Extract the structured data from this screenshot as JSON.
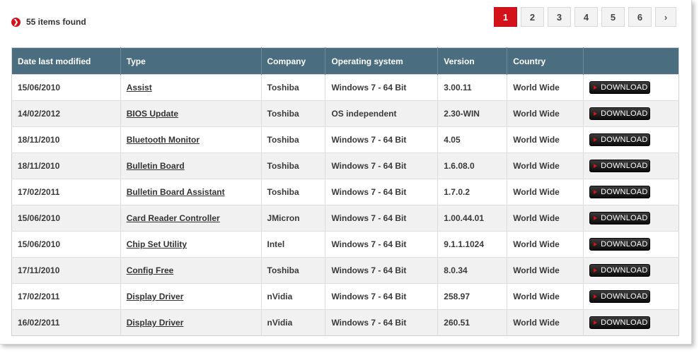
{
  "results": {
    "count_text": "55 items found"
  },
  "pagination": {
    "pages": [
      "1",
      "2",
      "3",
      "4",
      "5",
      "6"
    ],
    "active": "1",
    "next": "›"
  },
  "columns": [
    "Date last modified",
    "Type",
    "Company",
    "Operating system",
    "Version",
    "Country",
    ""
  ],
  "download_label": "DOWNLOAD",
  "rows": [
    {
      "date": "15/06/2010",
      "type": "Assist",
      "company": "Toshiba",
      "os": "Windows 7 - 64 Bit",
      "version": "3.00.11",
      "country": "World Wide"
    },
    {
      "date": "14/02/2012",
      "type": "BIOS Update",
      "company": "Toshiba",
      "os": "OS independent",
      "version": "2.30-WIN",
      "country": "World Wide"
    },
    {
      "date": "18/11/2010",
      "type": "Bluetooth Monitor",
      "company": "Toshiba",
      "os": "Windows 7 - 64 Bit",
      "version": "4.05",
      "country": "World Wide"
    },
    {
      "date": "18/11/2010",
      "type": "Bulletin Board",
      "company": "Toshiba",
      "os": "Windows 7 - 64 Bit",
      "version": "1.6.08.0",
      "country": "World Wide"
    },
    {
      "date": "17/02/2011",
      "type": "Bulletin Board Assistant",
      "company": "Toshiba",
      "os": "Windows 7 - 64 Bit",
      "version": "1.7.0.2",
      "country": "World Wide"
    },
    {
      "date": "15/06/2010",
      "type": "Card Reader Controller",
      "company": "JMicron",
      "os": "Windows 7 - 64 Bit",
      "version": "1.00.44.01",
      "country": "World Wide"
    },
    {
      "date": "15/06/2010",
      "type": "Chip Set Utility",
      "company": "Intel",
      "os": "Windows 7 - 64 Bit",
      "version": "9.1.1.1024",
      "country": "World Wide"
    },
    {
      "date": "17/11/2010",
      "type": "Config Free",
      "company": "Toshiba",
      "os": "Windows 7 - 64 Bit",
      "version": "8.0.34",
      "country": "World Wide"
    },
    {
      "date": "17/02/2011",
      "type": "Display Driver",
      "company": "nVidia",
      "os": "Windows 7 - 64 Bit",
      "version": "258.97",
      "country": "World Wide"
    },
    {
      "date": "16/02/2011",
      "type": "Display Driver",
      "company": "nVidia",
      "os": "Windows 7 - 64 Bit",
      "version": "260.51",
      "country": "World Wide"
    }
  ],
  "colors": {
    "accent": "#d4121b",
    "header_bg": "#4a6e80",
    "row_alt_bg": "#f1f1f1"
  },
  "icons": {
    "results_bullet": "chevron-right-circle-icon",
    "download_bullet": "play-icon"
  }
}
